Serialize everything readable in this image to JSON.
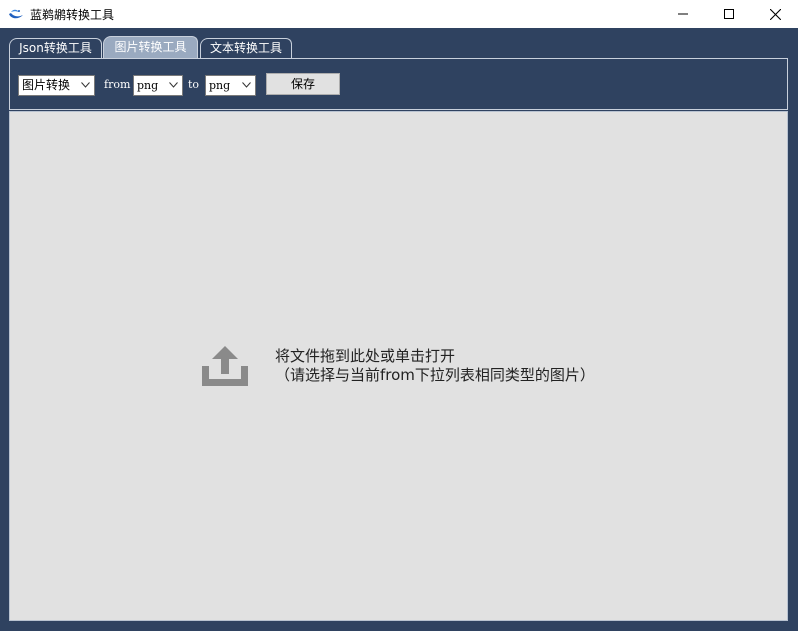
{
  "window": {
    "title": "蓝鹈鹕转换工具",
    "icon": "pelican-logo-icon",
    "controls": [
      "minimize-icon",
      "maximize-icon",
      "close-icon"
    ]
  },
  "tabs": [
    {
      "label": "Json转换工具",
      "active": false
    },
    {
      "label": "图片转换工具",
      "active": true
    },
    {
      "label": "文本转换工具",
      "active": false
    }
  ],
  "toolbar": {
    "mode_value": "图片转换",
    "from_label": "from",
    "from_value": "png",
    "to_label": "to",
    "to_value": "png",
    "save_label": "保存"
  },
  "dropzone": {
    "icon": "upload-icon",
    "line1": "将文件拖到此处或单击打开",
    "line2": "（请选择与当前from下拉列表相同类型的图片）"
  },
  "colors": {
    "window_bg": "#2f4260",
    "active_tab": "#9aaac0",
    "dropzone_bg": "#e1e1e1",
    "upload_icon": "#8a8a8a"
  }
}
